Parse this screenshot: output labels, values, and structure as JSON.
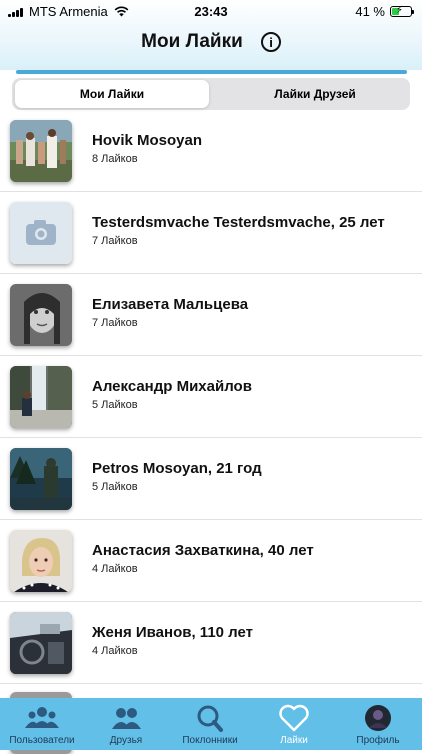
{
  "status_bar": {
    "carrier": "MTS Armenia",
    "time": "23:43",
    "battery": "41 %",
    "battery_level": 0.41
  },
  "header": {
    "title": "Мои Лайки",
    "info_icon": "info-circle-icon"
  },
  "segments": {
    "active": "Мои Лайки",
    "inactive": "Лайки Друзей"
  },
  "people": [
    {
      "name": "Hovik Mosoyan",
      "likes": "8 Лайков",
      "avatar": "group-photo"
    },
    {
      "name": "Testerdsmvache Testerdsmvache, 25 лет",
      "likes": "7 Лайков",
      "avatar": "camera-placeholder-icon"
    },
    {
      "name": "Елизавета Мальцева",
      "likes": "7 Лайков",
      "avatar": "bw-portrait"
    },
    {
      "name": "Александр Михайлов",
      "likes": "5 Лайков",
      "avatar": "waterfall-photo"
    },
    {
      "name": "Petros Mosoyan, 21 год",
      "likes": "5 Лайков",
      "avatar": "forest-photo"
    },
    {
      "name": "Анастасия Захваткина, 40 лет",
      "likes": "4 Лайков",
      "avatar": "portrait-photo"
    },
    {
      "name": "Женя Иванов, 110 лет",
      "likes": "4 Лайков",
      "avatar": "car-interior-photo"
    }
  ],
  "tabs": [
    {
      "label": "Пользователи",
      "icon": "users-icon"
    },
    {
      "label": "Друзья",
      "icon": "friends-icon"
    },
    {
      "label": "Поклонники",
      "icon": "search-icon"
    },
    {
      "label": "Лайки",
      "icon": "heart-icon",
      "active": true
    },
    {
      "label": "Профиль",
      "icon": "profile-avatar"
    }
  ]
}
